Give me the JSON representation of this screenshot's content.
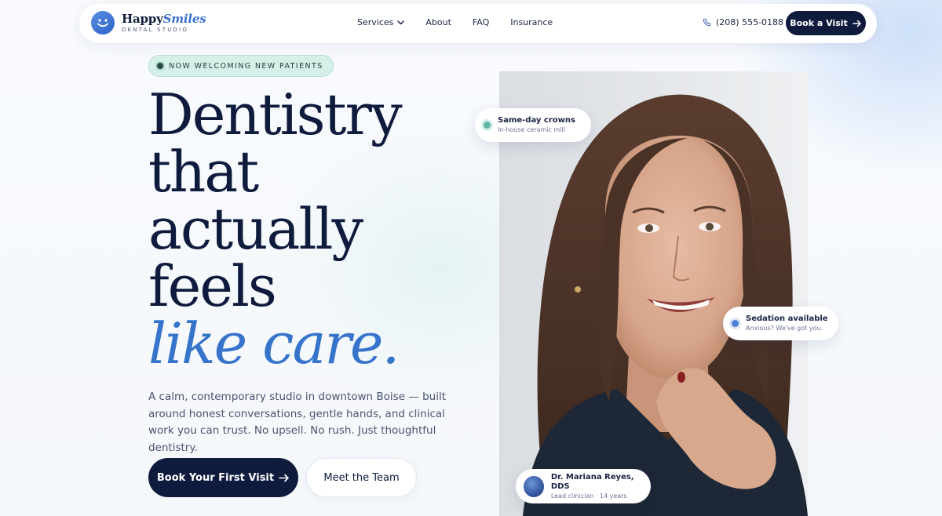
{
  "brand": {
    "name_part1": "Happy",
    "name_part2": "Smiles",
    "tagline": "DENTAL STUDIO"
  },
  "nav": {
    "links": [
      {
        "label": "Services",
        "has_dropdown": true
      },
      {
        "label": "About"
      },
      {
        "label": "FAQ"
      },
      {
        "label": "Insurance"
      }
    ],
    "phone": "(208) 555-0188",
    "cta_label": "Book a Visit"
  },
  "hero": {
    "badge": "NOW WELCOMING NEW PATIENTS",
    "headline_lines": [
      "Dentistry",
      "that",
      "actually",
      "feels"
    ],
    "headline_accent": "like care.",
    "lede": "A calm, contemporary studio in downtown Boise — built around honest conversations, gentle hands, and clinical work you can trust. No upsell. No rush. Just thoughtful dentistry.",
    "primary_cta": "Book Your First Visit",
    "secondary_cta": "Meet the Team"
  },
  "chips": {
    "crowns": {
      "title": "Same-day crowns",
      "subtitle": "In-house ceramic mill"
    },
    "sedation": {
      "title": "Sedation available",
      "subtitle": "Anxious? We've got you."
    },
    "doctor": {
      "name": "Dr. Mariana Reyes, DDS",
      "role": "Lead clinician · 14 years"
    }
  },
  "colors": {
    "navy": "#0f1b3d",
    "accent_blue": "#3674cc",
    "badge_mint": "#d6efe8",
    "teal_dot": "#5fb7a3"
  }
}
